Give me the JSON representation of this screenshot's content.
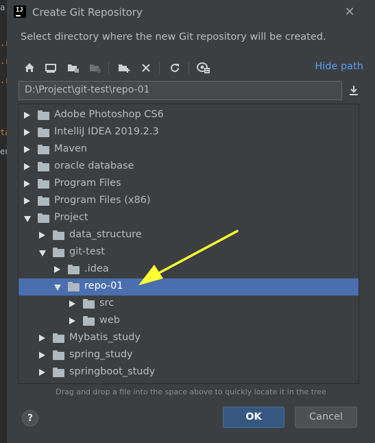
{
  "dialog": {
    "title": "Create Git Repository",
    "description": "Select directory where the new Git repository will be created.",
    "hide_path_label": "Hide path",
    "path_value": "D:\\Project\\git-test\\repo-01",
    "hint": "Drag and drop a file into the space above to quickly locate it in the tree",
    "help_label": "?",
    "ok_label": "OK",
    "cancel_label": "Cancel",
    "app_logo_text": "IJ"
  },
  "toolbar_icons": [
    "home-icon",
    "desktop-icon",
    "project-folder-icon",
    "module-folder-icon",
    "new-folder-icon",
    "delete-icon",
    "refresh-icon",
    "show-hidden-icon"
  ],
  "tree": {
    "items": [
      {
        "label": "Adobe Photoshop CS6",
        "level": 0,
        "state": "collapsed"
      },
      {
        "label": "IntelliJ IDEA 2019.2.3",
        "level": 0,
        "state": "collapsed"
      },
      {
        "label": "Maven",
        "level": 0,
        "state": "collapsed"
      },
      {
        "label": "oracle database",
        "level": 0,
        "state": "collapsed"
      },
      {
        "label": "Program Files",
        "level": 0,
        "state": "collapsed"
      },
      {
        "label": "Program Files (x86)",
        "level": 0,
        "state": "collapsed"
      },
      {
        "label": "Project",
        "level": 0,
        "state": "expanded"
      },
      {
        "label": " data_structure",
        "level": 1,
        "state": "collapsed"
      },
      {
        "label": "git-test",
        "level": 1,
        "state": "expanded"
      },
      {
        "label": ".idea",
        "level": 2,
        "state": "collapsed"
      },
      {
        "label": "repo-01",
        "level": 2,
        "state": "expanded",
        "selected": true
      },
      {
        "label": "src",
        "level": 3,
        "state": "collapsed"
      },
      {
        "label": "web",
        "level": 3,
        "state": "collapsed"
      },
      {
        "label": "Mybatis_study",
        "level": 1,
        "state": "collapsed"
      },
      {
        "label": "spring_study",
        "level": 1,
        "state": "collapsed"
      },
      {
        "label": "springboot_study",
        "level": 1,
        "state": "collapsed"
      }
    ]
  },
  "colors": {
    "background": "#3c3f41",
    "selection": "#4b6eaf",
    "link": "#589df6",
    "ok_button": "#365880",
    "annotation_arrow": "#ffff33"
  }
}
